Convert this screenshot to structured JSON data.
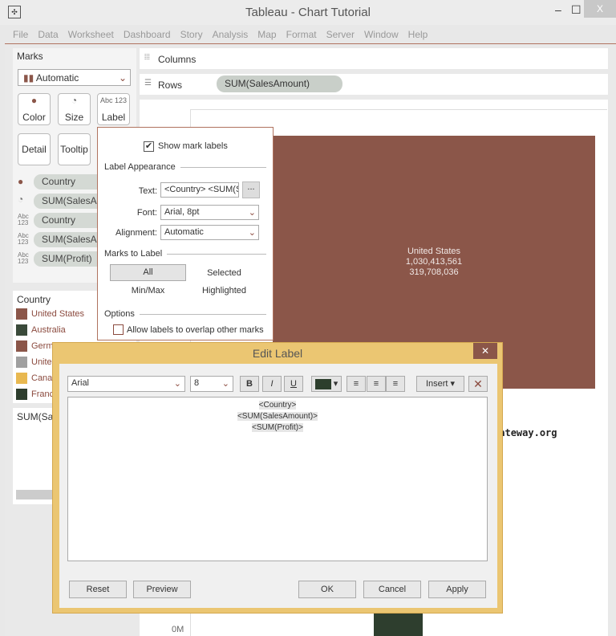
{
  "window": {
    "title": "Tableau - Chart Tutorial",
    "close": "X"
  },
  "menu": [
    "File",
    "Data",
    "Worksheet",
    "Dashboard",
    "Story",
    "Analysis",
    "Map",
    "Format",
    "Server",
    "Window",
    "Help"
  ],
  "marks": {
    "title": "Marks",
    "type": "Automatic",
    "buttons": [
      "Color",
      "Size",
      "Label",
      "Detail",
      "Tooltip"
    ],
    "label_icon": "Abc 123",
    "pills": [
      "Country",
      "SUM(SalesAmount)",
      "Country",
      "SUM(SalesAmount)",
      "SUM(Profit)"
    ]
  },
  "legend": {
    "title": "Country",
    "items": [
      {
        "name": "United States",
        "color": "#8b5649"
      },
      {
        "name": "Australia",
        "color": "#3a4a3a"
      },
      {
        "name": "Germany",
        "color": "#8b5649"
      },
      {
        "name": "United Kingdom",
        "color": "#a0a0a0"
      },
      {
        "name": "Canada",
        "color": "#e8b850"
      },
      {
        "name": "France",
        "color": "#2e3e2e"
      }
    ]
  },
  "size_card": {
    "title": "SUM(SalesAmount)"
  },
  "shelves": {
    "columns": "Columns",
    "rows": "Rows",
    "rows_pill": "SUM(SalesAmount)"
  },
  "chart": {
    "axis_tick_bottom": "0M",
    "bar_label": {
      "country": "United States",
      "sales": "1,030,413,561",
      "profit": "319,708,036"
    },
    "bar_color": "#8b5649"
  },
  "label_popup": {
    "show_mark_labels": "Show mark labels",
    "show_checked": true,
    "appearance": "Label Appearance",
    "text_label": "Text:",
    "text_value": "<Country> <SUM(SalesAmount)>",
    "ellipsis": "...",
    "font_label": "Font:",
    "font_value": "Arial, 8pt",
    "alignment_label": "Alignment:",
    "alignment_value": "Automatic",
    "marks_to_label": "Marks to Label",
    "options_marks": [
      "All",
      "Selected",
      "Min/Max",
      "Highlighted"
    ],
    "selected_option": "All",
    "options": "Options",
    "allow_overlap": "Allow labels to overlap other marks",
    "allow_overlap_checked": false
  },
  "edit_label": {
    "title": "Edit Label",
    "font": "Arial",
    "size": "8",
    "bold": "B",
    "italic": "I",
    "underline": "U",
    "text_color": "#2c3e2c",
    "insert": "Insert",
    "content": [
      "<Country>",
      "<SUM(SalesAmount)>",
      "<SUM(Profit)>"
    ],
    "buttons": {
      "reset": "Reset",
      "preview": "Preview",
      "ok": "OK",
      "cancel": "Cancel",
      "apply": "Apply"
    }
  },
  "watermark": "©tutorialgateway.org"
}
